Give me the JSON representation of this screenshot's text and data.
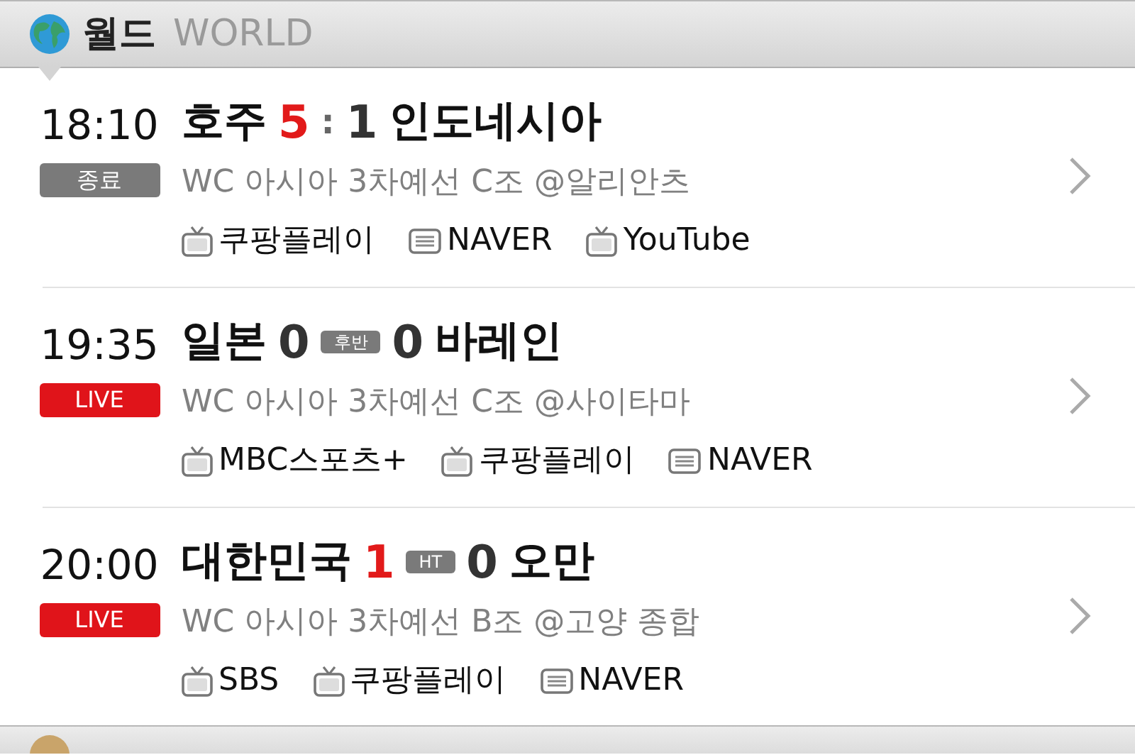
{
  "sections": [
    {
      "title": "월드",
      "subtitle": "WORLD",
      "matches": [
        {
          "time": "18:10",
          "status": {
            "kind": "final",
            "label": "종료"
          },
          "home": {
            "name": "호주",
            "score": "5",
            "winner": true
          },
          "separator": ":",
          "away": {
            "name": "인도네시아",
            "score": "1",
            "winner": false
          },
          "info": "WC 아시아 3차예선 C조 @알리안츠",
          "broadcasts": [
            {
              "kind": "tv",
              "name": "쿠팡플레이"
            },
            {
              "kind": "web",
              "name": "NAVER"
            },
            {
              "kind": "tv",
              "name": "YouTube"
            }
          ]
        },
        {
          "time": "19:35",
          "status": {
            "kind": "live",
            "label": "LIVE"
          },
          "home": {
            "name": "일본",
            "score": "0",
            "winner": false
          },
          "period": "후반",
          "away": {
            "name": "바레인",
            "score": "0",
            "winner": false
          },
          "info": "WC 아시아 3차예선 C조 @사이타마",
          "broadcasts": [
            {
              "kind": "tv",
              "name": "MBC스포츠+"
            },
            {
              "kind": "tv",
              "name": "쿠팡플레이"
            },
            {
              "kind": "web",
              "name": "NAVER"
            }
          ]
        },
        {
          "time": "20:00",
          "status": {
            "kind": "live",
            "label": "LIVE"
          },
          "home": {
            "name": "대한민국",
            "score": "1",
            "winner": true
          },
          "period": "HT",
          "away": {
            "name": "오만",
            "score": "0",
            "winner": false
          },
          "info": "WC 아시아 3차예선 B조 @고양 종합",
          "broadcasts": [
            {
              "kind": "tv",
              "name": "SBS"
            },
            {
              "kind": "tv",
              "name": "쿠팡플레이"
            },
            {
              "kind": "web",
              "name": "NAVER"
            }
          ]
        }
      ]
    }
  ]
}
